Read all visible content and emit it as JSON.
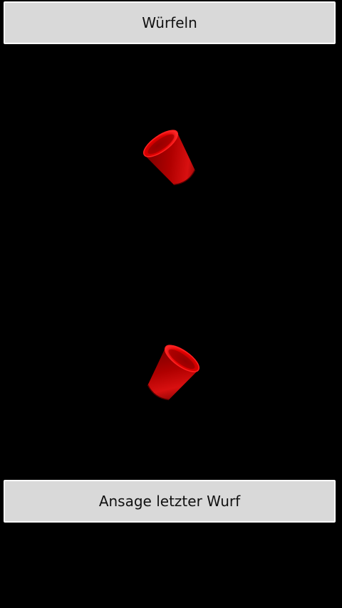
{
  "buttons": {
    "roll_label": "Würfeln",
    "announce_label": "Ansage letzter Wurf"
  },
  "cups": [
    {
      "name": "dice-cup-top",
      "color": "#cc0000"
    },
    {
      "name": "dice-cup-bottom",
      "color": "#cc0000"
    }
  ],
  "colors": {
    "background": "#000000",
    "button_bg": "#d9d9d9",
    "button_border": "#ffffff",
    "cup_red": "#cc0000"
  }
}
